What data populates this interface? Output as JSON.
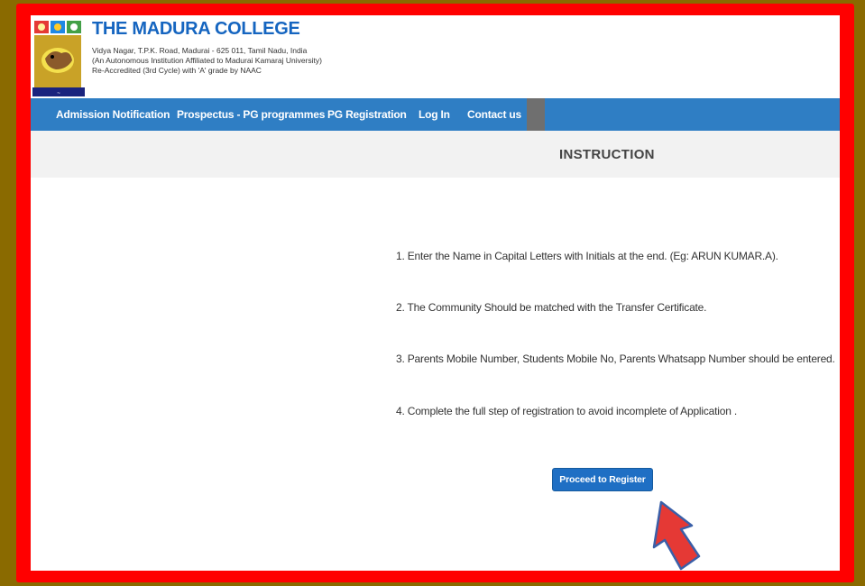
{
  "header": {
    "title": "THE MADURA COLLEGE",
    "address_lines": [
      "Vidya Nagar, T.P.K. Road, Madurai - 625 011, Tamil Nadu, India",
      "(An Autonomous Institution Affiliated to Madurai Kamaraj University)",
      "Re-Accredited (3rd Cycle) with 'A' grade by NAAC"
    ]
  },
  "nav": {
    "items": [
      {
        "label": "Admission Notification"
      },
      {
        "label": "Prospectus - PG programmes"
      },
      {
        "label": "PG Registration"
      },
      {
        "label": "Log In"
      },
      {
        "label": "Contact us"
      }
    ]
  },
  "main": {
    "title": "INSTRUCTION",
    "instructions": [
      "1. Enter the Name in Capital Letters with Initials at the end. (Eg: ARUN KUMAR.A).",
      "2. The Community Should be matched with the Transfer Certificate.",
      "3. Parents Mobile Number, Students Mobile No, Parents Whatsapp Number should be entered.",
      "4. Complete the full step of registration to avoid incomplete of Application ."
    ],
    "proceed_label": "Proceed to Register"
  },
  "colors": {
    "frame": "#ff0000",
    "background": "#8a6a00",
    "nav": "#2f7ec4",
    "title": "#1565c0",
    "button": "#1f6fc4",
    "arrow": "#e53935"
  },
  "icons": {
    "logo": "college-crest-icon",
    "pointer": "arrow-up-pointer-icon"
  }
}
